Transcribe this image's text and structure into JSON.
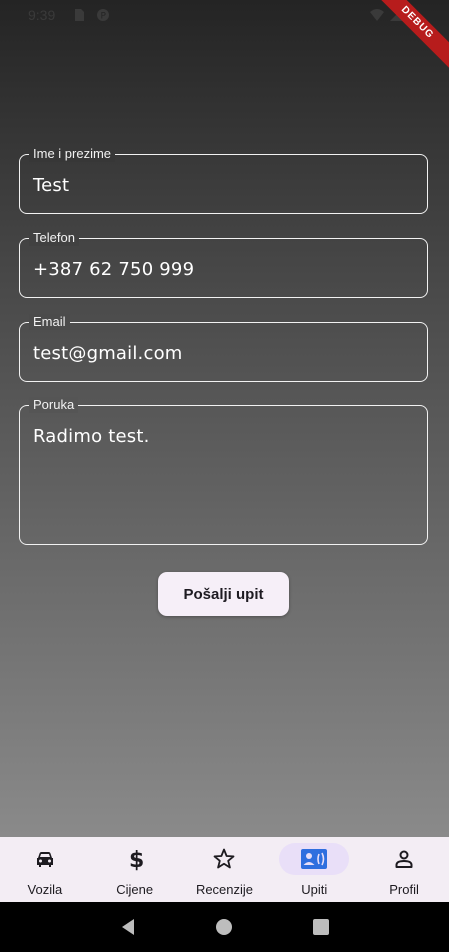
{
  "status_bar": {
    "time": "9:39",
    "debug_label": "DEBUG"
  },
  "form": {
    "fields": [
      {
        "label": "Ime i prezime",
        "value": "Test"
      },
      {
        "label": "Telefon",
        "value": "+387 62 750 999"
      },
      {
        "label": "Email",
        "value": "test@gmail.com"
      },
      {
        "label": "Poruka",
        "value": "Radimo test."
      }
    ],
    "submit_label": "Pošalji upit"
  },
  "bottom_nav": {
    "items": [
      {
        "label": "Vozila",
        "icon": "car-icon",
        "active": false
      },
      {
        "label": "Cijene",
        "icon": "dollar-icon",
        "active": false
      },
      {
        "label": "Recenzije",
        "icon": "star-icon",
        "active": false
      },
      {
        "label": "Upiti",
        "icon": "contact-card-icon",
        "active": true
      },
      {
        "label": "Profil",
        "icon": "person-icon",
        "active": false
      }
    ]
  },
  "colors": {
    "accent": "#2f6fdf",
    "nav_active_bg": "#e9dff8",
    "nav_bg": "#f3edf4"
  }
}
